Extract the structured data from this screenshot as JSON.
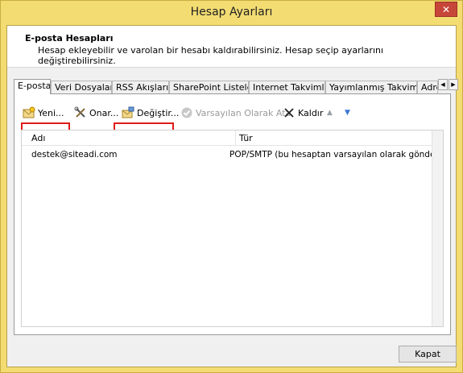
{
  "window": {
    "title": "Hesap Ayarları",
    "close_glyph": "✕"
  },
  "header": {
    "title": "E-posta Hesapları",
    "description": "Hesap ekleyebilir ve varolan bir hesabı kaldırabilirsiniz. Hesap seçip ayarlarını değiştirebilirsiniz."
  },
  "tabs": [
    {
      "label": "E-posta",
      "active": true
    },
    {
      "label": "Veri Dosyaları"
    },
    {
      "label": "RSS Akışları"
    },
    {
      "label": "SharePoint Listeleri"
    },
    {
      "label": "Internet Takvimleri"
    },
    {
      "label": "Yayımlanmış Takvimler"
    },
    {
      "label": "Adres"
    }
  ],
  "tab_scroll": {
    "left": "◀",
    "right": "▶"
  },
  "toolbar": {
    "new_label": "Yeni...",
    "repair_label": "Onar...",
    "change_label": "Değiştir...",
    "set_default_label": "Varsayılan Olarak Ata",
    "remove_label": "Kaldır",
    "up_glyph": "▲",
    "down_glyph": "▼"
  },
  "list": {
    "columns": [
      "Adı",
      "Tür"
    ],
    "rows": [
      {
        "name": "destek@siteadi.com",
        "type": "POP/SMTP (bu hesaptan varsayılan olarak gönder)"
      }
    ]
  },
  "footer": {
    "close_label": "Kapat"
  },
  "colors": {
    "highlight": "#e01a1a",
    "frame": "#f3dc72"
  }
}
